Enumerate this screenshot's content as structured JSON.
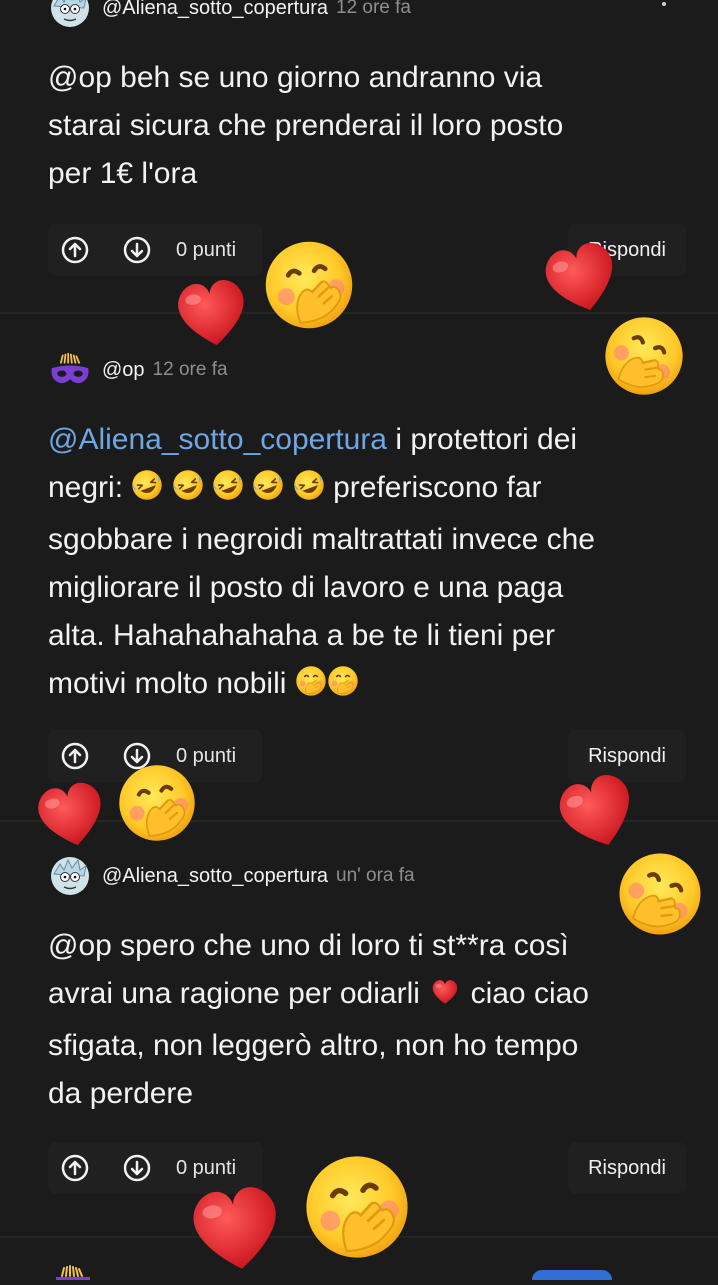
{
  "colors": {
    "background": "#1b1b1b",
    "mention": "#6ea7e6",
    "timestamp": "#8e8e8e",
    "button_bg": "#202020"
  },
  "comments": [
    {
      "username": "@Aliena_sotto_copertura",
      "time": "12 ore fa",
      "avatar_icon": "rick-avatar-icon",
      "text_lines": [
        "@op beh se uno giorno andranno via",
        "starai sicura che prenderai il loro posto",
        "per 1€ l'ora"
      ],
      "points": "0 punti",
      "reply": "Rispondi"
    },
    {
      "username": "@op",
      "time": "12 ore fa",
      "avatar_icon": "purple-mask-avatar-icon",
      "mention": "@Aliena_sotto_copertura",
      "text_line1_rest": " i protettori dei",
      "text_line2_start": "negri: ",
      "text_line2_end": " preferiscono far",
      "text_lines_rest": [
        "sgobbare i negroidi maltrattati invece che",
        "migliorare il posto di lavoro e una paga",
        "alta. Hahahahahaha a be te li tieni per"
      ],
      "text_last": "motivi molto nobili ",
      "points": "0 punti",
      "reply": "Rispondi"
    },
    {
      "username": "@Aliena_sotto_copertura",
      "time": "un' ora fa",
      "avatar_icon": "rick-avatar-icon",
      "text_line1": "@op spero che uno di loro ti st**ra così",
      "text_line2_start": "avrai una ragione per odiarli ",
      "text_line2_end": " ciao ciao",
      "text_lines_rest": [
        "sfigata, non leggerò altro, non ho tempo",
        "da perdere"
      ],
      "points": "0 punti",
      "reply": "Rispondi"
    }
  ]
}
